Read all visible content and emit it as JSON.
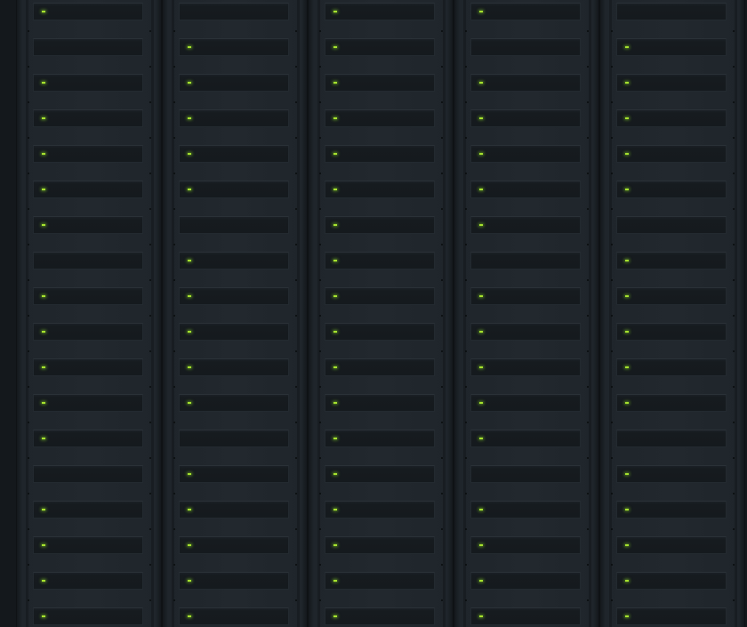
{
  "led_color": "#a6e22e",
  "rack_count": 5,
  "units_per_rack": 18,
  "racks": [
    {
      "leds": [
        1,
        0,
        1,
        1,
        1,
        1,
        1,
        0,
        1,
        1,
        1,
        1,
        1,
        0,
        1,
        1,
        1,
        1
      ]
    },
    {
      "leds": [
        0,
        1,
        1,
        1,
        1,
        1,
        0,
        1,
        1,
        1,
        1,
        1,
        0,
        1,
        1,
        1,
        1,
        1
      ]
    },
    {
      "leds": [
        1,
        1,
        1,
        1,
        1,
        1,
        1,
        1,
        1,
        1,
        1,
        1,
        1,
        1,
        1,
        1,
        1,
        1
      ]
    },
    {
      "leds": [
        1,
        0,
        1,
        1,
        1,
        1,
        1,
        0,
        1,
        1,
        1,
        1,
        1,
        0,
        1,
        1,
        1,
        1
      ]
    },
    {
      "leds": [
        0,
        1,
        1,
        1,
        1,
        1,
        0,
        1,
        1,
        1,
        1,
        1,
        0,
        1,
        1,
        1,
        1,
        1
      ]
    }
  ]
}
